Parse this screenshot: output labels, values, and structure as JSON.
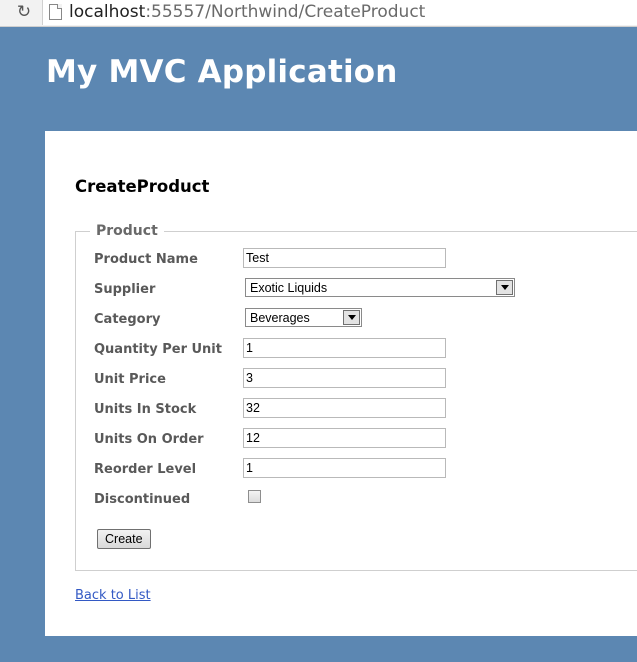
{
  "browser": {
    "url_host": "localhost",
    "url_path": ":55557/Northwind/CreateProduct"
  },
  "app": {
    "title": "My MVC Application"
  },
  "page": {
    "heading": "CreateProduct"
  },
  "form": {
    "legend": "Product",
    "fields": {
      "product_name": {
        "label": "Product Name",
        "value": "Test"
      },
      "supplier": {
        "label": "Supplier",
        "selected": "Exotic Liquids"
      },
      "category": {
        "label": "Category",
        "selected": "Beverages"
      },
      "quantity_per_unit": {
        "label": "Quantity Per Unit",
        "value": "1"
      },
      "unit_price": {
        "label": "Unit Price",
        "value": "3"
      },
      "units_in_stock": {
        "label": "Units In Stock",
        "value": "32"
      },
      "units_on_order": {
        "label": "Units On Order",
        "value": "12"
      },
      "reorder_level": {
        "label": "Reorder Level",
        "value": "1"
      },
      "discontinued": {
        "label": "Discontinued",
        "checked": false
      }
    },
    "submit_label": "Create"
  },
  "links": {
    "back": "Back to List"
  },
  "colors": {
    "header_bg": "#5c87b2",
    "link": "#3359c4",
    "label": "#595959"
  }
}
